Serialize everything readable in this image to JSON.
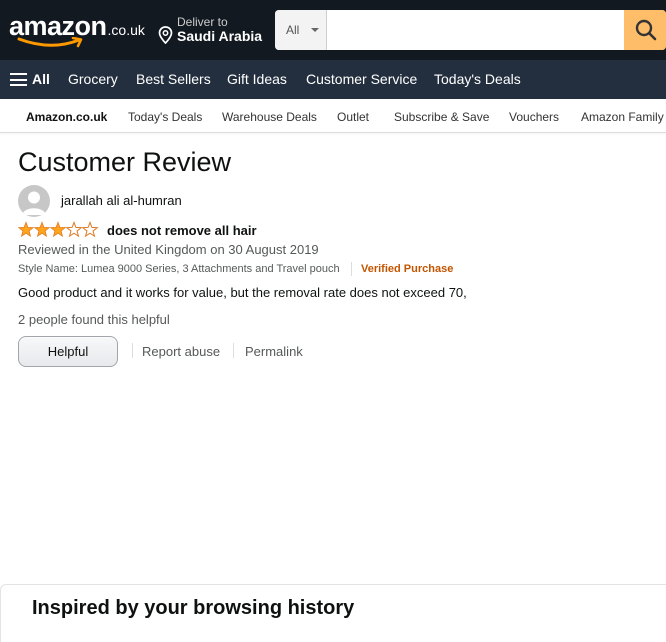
{
  "header": {
    "logo_text": "amazon",
    "logo_tld": ".co.uk",
    "deliver_line1": "Deliver to",
    "deliver_line2": "Saudi Arabia",
    "search_category": "All",
    "search_placeholder": "",
    "accent_color": "#febd69"
  },
  "nav": {
    "all_label": "All",
    "items": [
      "Grocery",
      "Best Sellers",
      "Gift Ideas",
      "Customer Service",
      "Today's Deals"
    ]
  },
  "subnav": {
    "items": [
      "Amazon.co.uk",
      "Today's Deals",
      "Warehouse Deals",
      "Outlet",
      "Subscribe & Save",
      "Vouchers",
      "Amazon Family"
    ]
  },
  "review": {
    "page_title": "Customer Review",
    "reviewer": "jarallah ali al-humran",
    "rating": 3,
    "rating_max": 5,
    "title": "does not remove all hair",
    "date": "Reviewed in the United Kingdom on 30 August 2019",
    "style": "Style Name: Lumea 9000 Series, 3 Attachments and Travel pouch",
    "verified": "Verified Purchase",
    "body": "Good product and it works for value, but the removal rate does not exceed 70,",
    "helpful_count": "2 people found this helpful",
    "helpful_button": "Helpful",
    "report": "Report abuse",
    "permalink": "Permalink",
    "star_color": "#ffa41c",
    "verified_color": "#c45500"
  },
  "inspired": {
    "title": "Inspired by your browsing history"
  }
}
